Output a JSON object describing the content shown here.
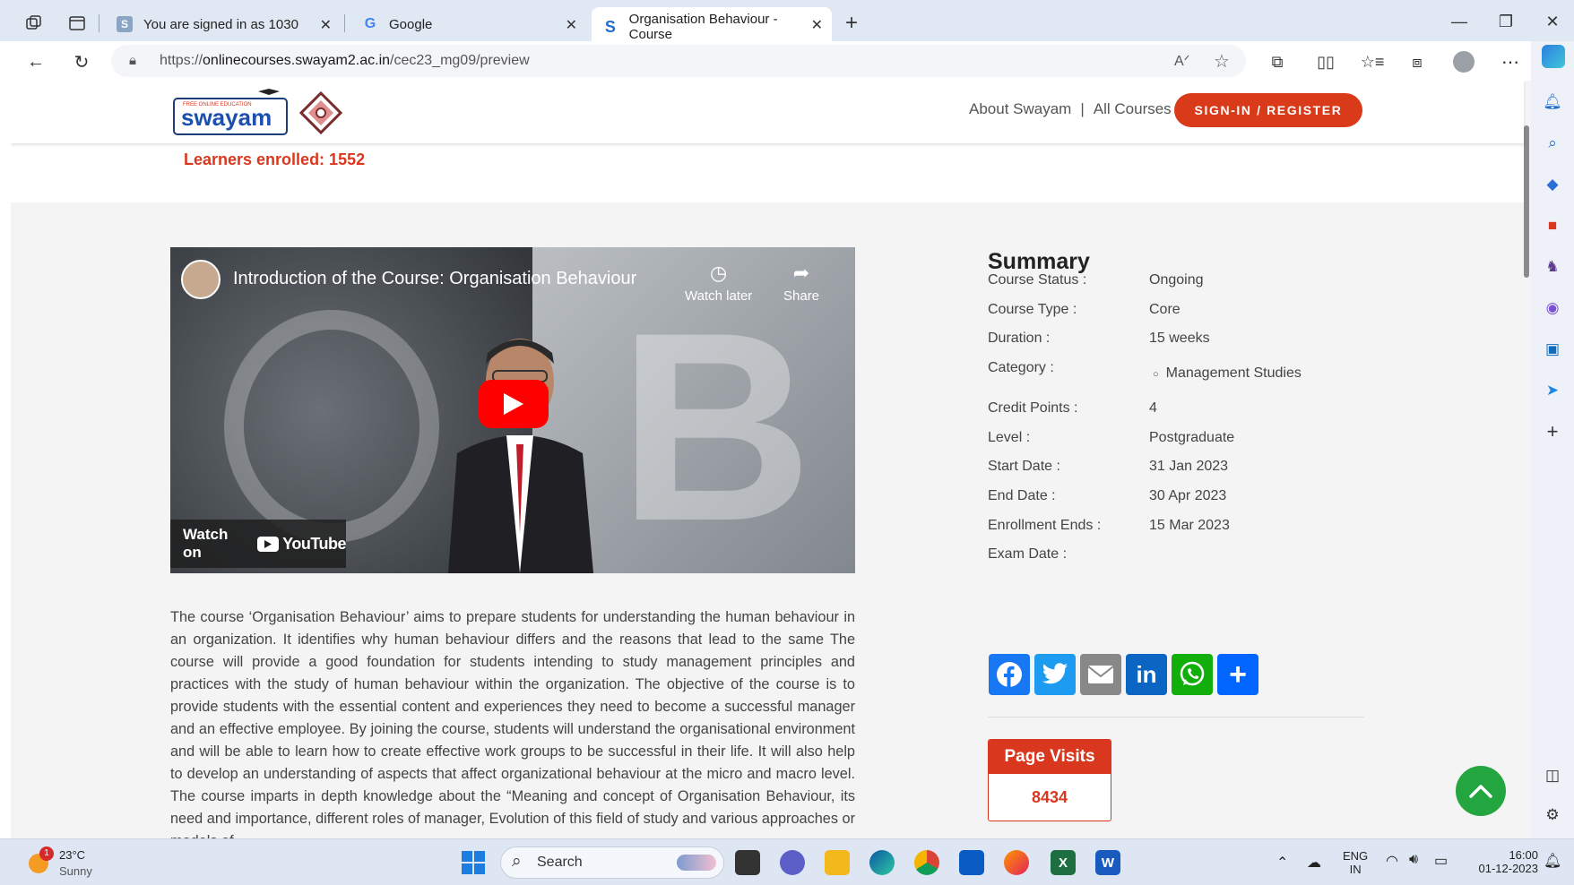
{
  "browser": {
    "tabs": [
      {
        "title": "You are signed in as 1030",
        "favicon": "S"
      },
      {
        "title": "Google",
        "favicon": "G"
      },
      {
        "title": "Organisation Behaviour - Course",
        "favicon": "S",
        "active": true
      }
    ],
    "url_prefix": "https://",
    "url_host": "onlinecourses.swayam2.ac.in",
    "url_path": "/cec23_mg09/preview"
  },
  "header": {
    "logo_text": "swayam",
    "logo_tagline": "FREE ONLINE EDUCATION",
    "links": [
      "About Swayam",
      "All Courses"
    ],
    "separator": "|",
    "signin_label": "SIGN-IN / REGISTER"
  },
  "course": {
    "enrolled": "Learners enrolled: 1552",
    "video_title": "Introduction of the Course: Organisation Behaviour",
    "watch_later": "Watch later",
    "share": "Share",
    "watch_on": "Watch on",
    "youtube": "YouTube",
    "description": "The course ‘Organisation Behaviour’ aims to prepare students for understanding the human behaviour in an organization. It identifies why human behaviour differs and the reasons that lead to the same The course will provide a good foundation for students intending to study management principles and practices with the study of human behaviour within the organization. The objective of the course is to provide students with the essential content and experiences they need to become a successful manager and an effective employee. By joining the course, students will understand the organisational environment and will be able to learn how to create effective work groups to be successful in their life. It will also help to develop an understanding of aspects that affect organizational behaviour at the micro and macro level. The course imparts in depth knowledge about the “Meaning and concept of Organisation Behaviour, its need and importance, different roles of manager, Evolution of this field of study and various approaches or models of"
  },
  "summary": {
    "title": "Summary",
    "rows": [
      {
        "label": "Course Status :",
        "value": "Ongoing"
      },
      {
        "label": "Course Type :",
        "value": "Core"
      },
      {
        "label": "Duration :",
        "value": "15 weeks"
      },
      {
        "label": "Category :",
        "value": "Management Studies"
      },
      {
        "label": "Credit Points :",
        "value": "4"
      },
      {
        "label": "Level :",
        "value": "Postgraduate"
      },
      {
        "label": "Start Date :",
        "value": "31 Jan 2023"
      },
      {
        "label": "End Date :",
        "value": "30 Apr 2023"
      },
      {
        "label": "Enrollment Ends :",
        "value": "15 Mar 2023"
      },
      {
        "label": "Exam Date :",
        "value": ""
      }
    ],
    "share_icons": [
      "facebook-icon",
      "twitter-icon",
      "email-icon",
      "linkedin-icon",
      "whatsapp-icon",
      "share-plus-icon"
    ],
    "page_visits_label": "Page Visits",
    "page_visits_value": "8434"
  },
  "taskbar": {
    "temperature": "23°C",
    "weather": "Sunny",
    "weather_badge": "1",
    "search_placeholder": "Search",
    "lang": "ENG",
    "region": "IN",
    "time": "16:00",
    "date": "01-12-2023"
  },
  "colors": {
    "brand_red": "#d9381e",
    "scroll_top_green": "#23a53f"
  }
}
